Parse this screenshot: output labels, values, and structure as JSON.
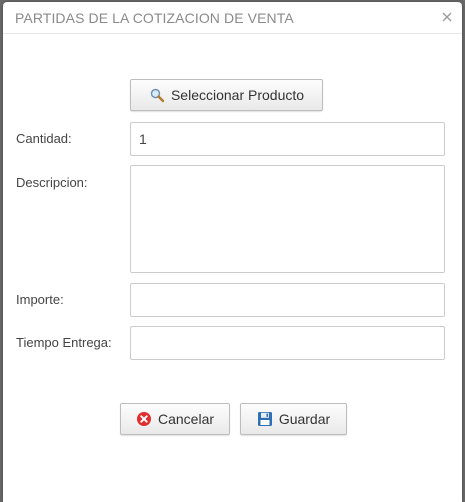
{
  "dialog": {
    "title": "PARTIDAS DE LA COTIZACION DE VENTA",
    "close_icon": "close-icon"
  },
  "select_product": {
    "label": "Seleccionar Producto",
    "icon": "magnifier-icon"
  },
  "form": {
    "cantidad": {
      "label": "Cantidad:",
      "value": "1"
    },
    "descripcion": {
      "label": "Descripcion:",
      "value": ""
    },
    "importe": {
      "label": "Importe:",
      "value": ""
    },
    "tiempo_entrega": {
      "label": "Tiempo Entrega:",
      "value": ""
    }
  },
  "actions": {
    "cancel_label": "Cancelar",
    "cancel_icon": "cancel-circle-icon",
    "save_label": "Guardar",
    "save_icon": "floppy-disk-icon"
  },
  "colors": {
    "cancel_icon": "#e02d2d",
    "save_icon": "#2f6fb5",
    "title_text": "#8a8a8a"
  }
}
